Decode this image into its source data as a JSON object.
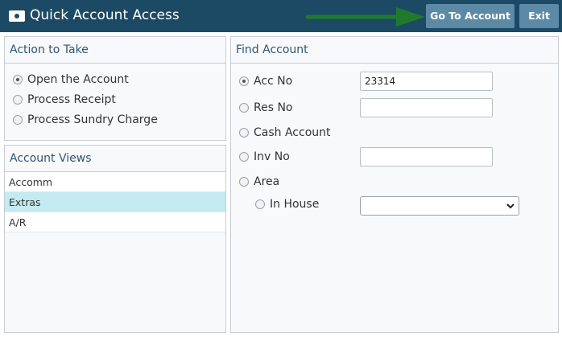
{
  "header": {
    "title": "Quick Account Access",
    "icon": "money-icon",
    "go_to_account_label": "Go To Account",
    "exit_label": "Exit"
  },
  "action_panel": {
    "title": "Action to Take",
    "options": [
      {
        "label": "Open the Account",
        "checked": true
      },
      {
        "label": "Process Receipt",
        "checked": false
      },
      {
        "label": "Process Sundry Charge",
        "checked": false
      }
    ]
  },
  "views_panel": {
    "title": "Account Views",
    "items": [
      {
        "label": "Accomm",
        "selected": false
      },
      {
        "label": "Extras",
        "selected": true
      },
      {
        "label": "A/R",
        "selected": false
      }
    ]
  },
  "find_panel": {
    "title": "Find Account",
    "acc_no_label": "Acc No",
    "acc_no_value": "23314",
    "res_no_label": "Res No",
    "res_no_value": "",
    "cash_account_label": "Cash Account",
    "inv_no_label": "Inv No",
    "inv_no_value": "",
    "area_label": "Area",
    "in_house_label": "In House",
    "in_house_value": ""
  },
  "colors": {
    "header_bg": "#1c4a64",
    "button_bg": "#5c8aa6",
    "arrow": "#1f7a2e",
    "selected_row": "#c3ebf1"
  }
}
